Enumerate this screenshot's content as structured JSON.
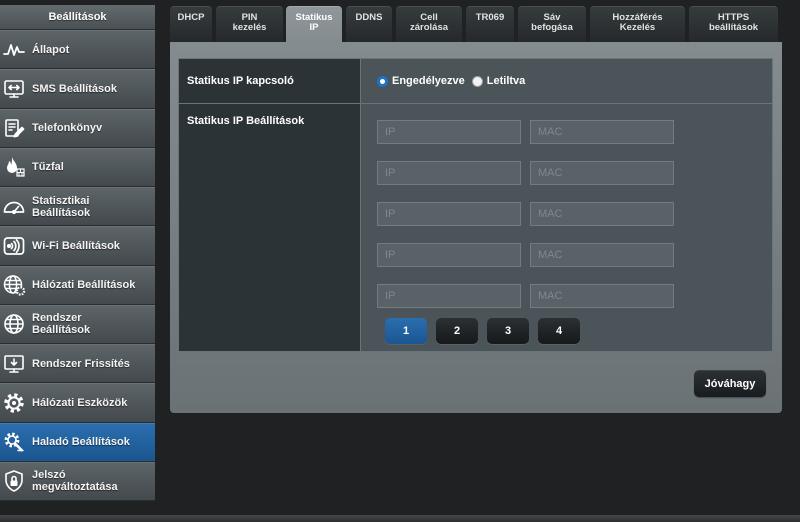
{
  "theme": {
    "accent": "#1a5690",
    "accent_light": "#2b6eae",
    "radio_checked": "#1f73c7"
  },
  "sidebar": {
    "title": "Beállítások",
    "items": [
      {
        "label": "Állapot",
        "icon": "pulse-icon",
        "active": false
      },
      {
        "label": "SMS Beállítások",
        "icon": "sms-icon",
        "active": false
      },
      {
        "label": "Telefonkönyv",
        "icon": "phonebook-icon",
        "active": false
      },
      {
        "label": "Tűzfal",
        "icon": "firewall-icon",
        "active": false
      },
      {
        "label": "Statisztikai\nBeállítások",
        "icon": "gauge-icon",
        "active": false
      },
      {
        "label": "Wi-Fi Beállítások",
        "icon": "wifi-icon",
        "active": false
      },
      {
        "label": "Hálózati Beállítások",
        "icon": "network-globe-icon",
        "active": false
      },
      {
        "label": "Rendszer\nBeállítások",
        "icon": "globe-icon",
        "active": false
      },
      {
        "label": "Rendszer Frissítés",
        "icon": "monitor-update-icon",
        "active": false
      },
      {
        "label": "Hálózati Eszközök",
        "icon": "gear-icon",
        "active": false
      },
      {
        "label": "Haladó Beállítások",
        "icon": "advanced-gear-icon",
        "active": true
      },
      {
        "label": "Jelszó\nmegváltoztatása",
        "icon": "lock-icon",
        "active": false
      }
    ]
  },
  "tabs": [
    {
      "label": "DHCP",
      "active": false
    },
    {
      "label": "PIN\nkezelés",
      "active": false
    },
    {
      "label": "Statikus\nIP",
      "active": true
    },
    {
      "label": "DDNS",
      "active": false
    },
    {
      "label": "Cell\nzárolása",
      "active": false
    },
    {
      "label": "TR069",
      "active": false
    },
    {
      "label": "Sáv\nbefogása",
      "active": false
    },
    {
      "label": "Hozzáférés\nKezelés",
      "active": false
    },
    {
      "label": "HTTPS\nbeállítások",
      "active": false
    }
  ],
  "static_ip": {
    "switch_label": "Statikus IP kapcsoló",
    "options": [
      {
        "label": "Engedélyezve",
        "checked": true
      },
      {
        "label": "Letiltva",
        "checked": false
      }
    ],
    "settings_label": "Statikus IP Beállítások",
    "ip_placeholder": "IP",
    "mac_placeholder": "MAC",
    "entries": [
      {
        "ip": "",
        "mac": ""
      },
      {
        "ip": "",
        "mac": ""
      },
      {
        "ip": "",
        "mac": ""
      },
      {
        "ip": "",
        "mac": ""
      },
      {
        "ip": "",
        "mac": ""
      }
    ]
  },
  "pagination": {
    "pages": [
      {
        "label": "1",
        "active": true
      },
      {
        "label": "2",
        "active": false
      },
      {
        "label": "3",
        "active": false
      },
      {
        "label": "4",
        "active": false
      }
    ]
  },
  "actions": {
    "apply_label": "Jóváhagy"
  }
}
